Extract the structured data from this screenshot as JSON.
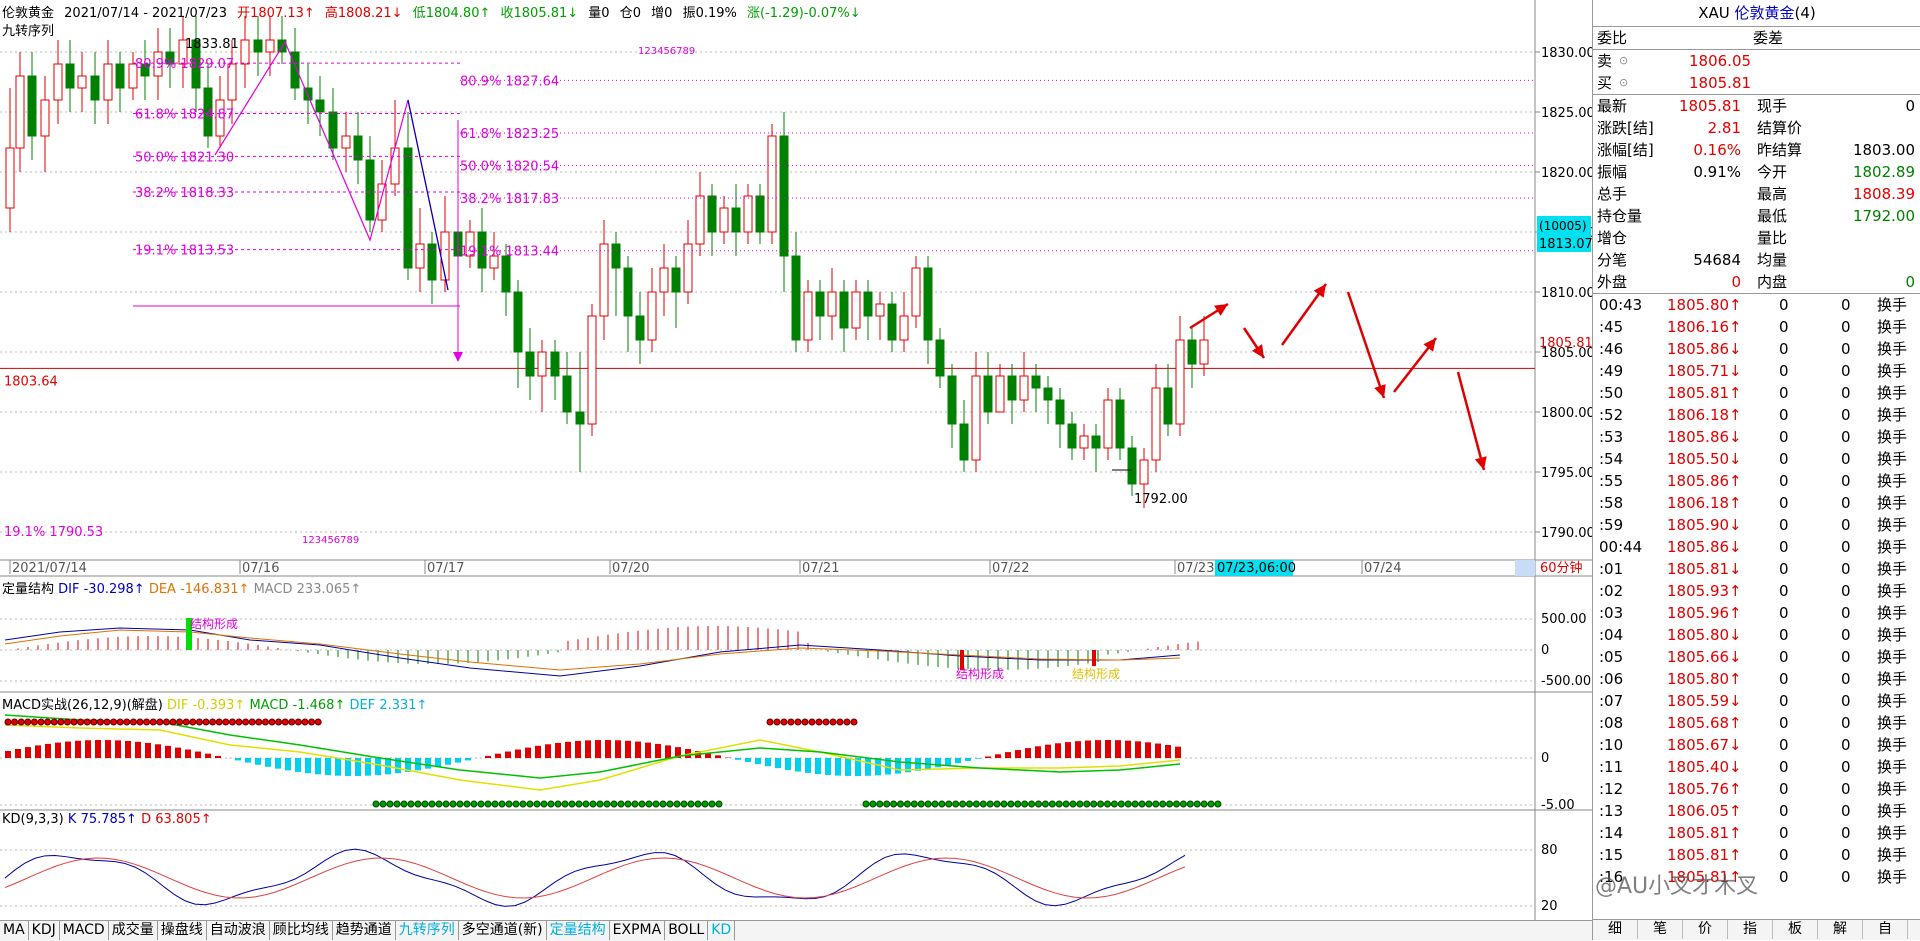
{
  "header": {
    "instrument": "伦敦黄金",
    "range": "2021/07/14 - 2021/07/23",
    "open": "开1807.13↑",
    "high": "高1808.21↓",
    "low": "低1804.80↑",
    "close": "收1805.81↓",
    "volume": "量0",
    "position": "仓0",
    "increase": "增0",
    "amplitude": "振0.19%",
    "change": "涨(-1.29)-0.07%↓",
    "indicator_name": "九转序列"
  },
  "main_chart": {
    "y_ticks": [
      "1830.00",
      "1825.00",
      "1820.00",
      "1815.00",
      "1810.00",
      "1805.00",
      "1800.00",
      "1795.00",
      "1790.00"
    ],
    "x_labels": [
      "2021/07/14",
      "07/16",
      "07/17",
      "07/20",
      "07/21",
      "07/22",
      "07/23",
      "07/24"
    ],
    "cursor_time": "07/23,06:00",
    "cursor_box_top": "(10005)",
    "cursor_box_price": "1813.07",
    "last_price_label": "1805.81",
    "period": "60分钟",
    "hline_label": "1803.64",
    "high_label": "1833.81",
    "low_label": "1792.00",
    "fib_left": [
      "80.9% 1829.07",
      "61.8% 1824.87",
      "50.0% 1821.30",
      "38.2% 1818.33",
      "19.1% 1813.53"
    ],
    "fib_right": [
      "80.9% 1827.64",
      "61.8% 1823.25",
      "50.0% 1820.54",
      "38.2% 1817.83",
      "19.1% 1813.44"
    ],
    "fib_bottom": "19.1% 1790.53",
    "nine_seq_top": "123456789",
    "nine_seq_bottom": "123456789",
    "colors": {
      "up": "#e00000",
      "down": "#008000",
      "fib": "#e000e0",
      "hline": "#d00000"
    }
  },
  "sub1": {
    "name": "定量结构",
    "dif": "DIF -30.298↑",
    "dea": "DEA -146.831↑",
    "macd": "MACD 233.065↑",
    "y_ticks": [
      "500.00",
      "0",
      "-500.00"
    ],
    "label_a": "结构形成",
    "label_b": "结构形成",
    "label_c": "结构形成"
  },
  "sub2": {
    "name": "MACD实战(26,12,9)(解盘)",
    "dif": "DIF -0.393↑",
    "macd": "MACD -1.468↑",
    "def": "DEF 2.331↑",
    "y_ticks": [
      "0",
      "-5.00"
    ]
  },
  "sub3": {
    "name": "KD(9,3,3)",
    "k": "K 75.785↑",
    "d": "D 63.805↑",
    "y_ticks": [
      "80",
      "20"
    ]
  },
  "bottom_tabs": [
    "MA",
    "KDJ",
    "MACD",
    "成交量",
    "操盘线",
    "自动波浪",
    "顾比均线",
    "趋势通道",
    "九转序列",
    "多空通道(新)",
    "定量结构",
    "EXPMA",
    "BOLL",
    "KD"
  ],
  "active_tabs": [
    "九转序列",
    "定量结构",
    "KD"
  ],
  "right_panel": {
    "title_code": "XAU",
    "title_name": "伦敦黄金",
    "title_count": "(4)",
    "weibi": "委比",
    "weicha": "委差",
    "sell_label": "卖",
    "sell_price": "1806.05",
    "buy_label": "买",
    "buy_price": "1805.81",
    "quote": [
      {
        "l": "最新",
        "v": "1805.81",
        "l2": "现手",
        "v2": "0",
        "c": "#e00000",
        "c2": "#000"
      },
      {
        "l": "涨跌[结]",
        "v": "2.81",
        "l2": "结算价",
        "v2": "",
        "c": "#e00000",
        "c2": "#000"
      },
      {
        "l": "涨幅[结]",
        "v": "0.16%",
        "l2": "昨结算",
        "v2": "1803.00",
        "c": "#e00000",
        "c2": "#000"
      },
      {
        "l": "振幅",
        "v": "0.91%",
        "l2": "今开",
        "v2": "1802.89",
        "c": "#000",
        "c2": "#008000"
      },
      {
        "l": "总手",
        "v": "",
        "l2": "最高",
        "v2": "1808.39",
        "c": "#000",
        "c2": "#e00000"
      },
      {
        "l": "持仓量",
        "v": "",
        "l2": "最低",
        "v2": "1792.00",
        "c": "#000",
        "c2": "#008000"
      },
      {
        "l": "增仓",
        "v": "",
        "l2": "量比",
        "v2": "",
        "c": "#000",
        "c2": "#000"
      },
      {
        "l": "分笔",
        "v": "54684",
        "l2": "均量",
        "v2": "",
        "c": "#000",
        "c2": "#000"
      },
      {
        "l": "外盘",
        "v": "0",
        "l2": "内盘",
        "v2": "0",
        "c": "#e00000",
        "c2": "#008000"
      }
    ],
    "ticks": [
      {
        "t": "00:43",
        "p": "1805.80↑",
        "c": "#e00000"
      },
      {
        "t": ":45",
        "p": "1806.16↑",
        "c": "#e00000"
      },
      {
        "t": ":46",
        "p": "1805.86↓",
        "c": "#e00000"
      },
      {
        "t": ":49",
        "p": "1805.71↓",
        "c": "#e00000"
      },
      {
        "t": ":50",
        "p": "1805.81↑",
        "c": "#e00000"
      },
      {
        "t": ":52",
        "p": "1806.18↑",
        "c": "#e00000"
      },
      {
        "t": ":53",
        "p": "1805.86↓",
        "c": "#e00000"
      },
      {
        "t": ":54",
        "p": "1805.50↓",
        "c": "#e00000"
      },
      {
        "t": ":55",
        "p": "1805.86↑",
        "c": "#e00000"
      },
      {
        "t": ":58",
        "p": "1806.18↑",
        "c": "#e00000"
      },
      {
        "t": ":59",
        "p": "1805.90↓",
        "c": "#e00000"
      },
      {
        "t": "00:44",
        "p": "1805.86↓",
        "c": "#e00000"
      },
      {
        "t": ":01",
        "p": "1805.81↓",
        "c": "#e00000"
      },
      {
        "t": ":02",
        "p": "1805.93↑",
        "c": "#e00000"
      },
      {
        "t": ":03",
        "p": "1805.96↑",
        "c": "#e00000"
      },
      {
        "t": ":04",
        "p": "1805.80↓",
        "c": "#e00000"
      },
      {
        "t": ":05",
        "p": "1805.66↓",
        "c": "#e00000"
      },
      {
        "t": ":06",
        "p": "1805.80↑",
        "c": "#e00000"
      },
      {
        "t": ":07",
        "p": "1805.59↓",
        "c": "#e00000"
      },
      {
        "t": ":08",
        "p": "1805.68↑",
        "c": "#e00000"
      },
      {
        "t": ":10",
        "p": "1805.67↓",
        "c": "#e00000"
      },
      {
        "t": ":11",
        "p": "1805.40↓",
        "c": "#e00000"
      },
      {
        "t": ":12",
        "p": "1805.76↑",
        "c": "#e00000"
      },
      {
        "t": ":13",
        "p": "1806.05↑",
        "c": "#e00000"
      },
      {
        "t": ":14",
        "p": "1805.81↑",
        "c": "#e00000"
      },
      {
        "t": ":15",
        "p": "1805.81↑",
        "c": "#e00000"
      },
      {
        "t": ":16",
        "p": "1805.81↑",
        "c": "#e00000"
      }
    ],
    "tick_vol": "0",
    "tick_vol2": "0",
    "tick_type": "换手",
    "bottom_tabs": [
      "细",
      "笔",
      "价",
      "指",
      "板",
      "解",
      "自"
    ],
    "watermark": "@AU小叉才木叉"
  }
}
